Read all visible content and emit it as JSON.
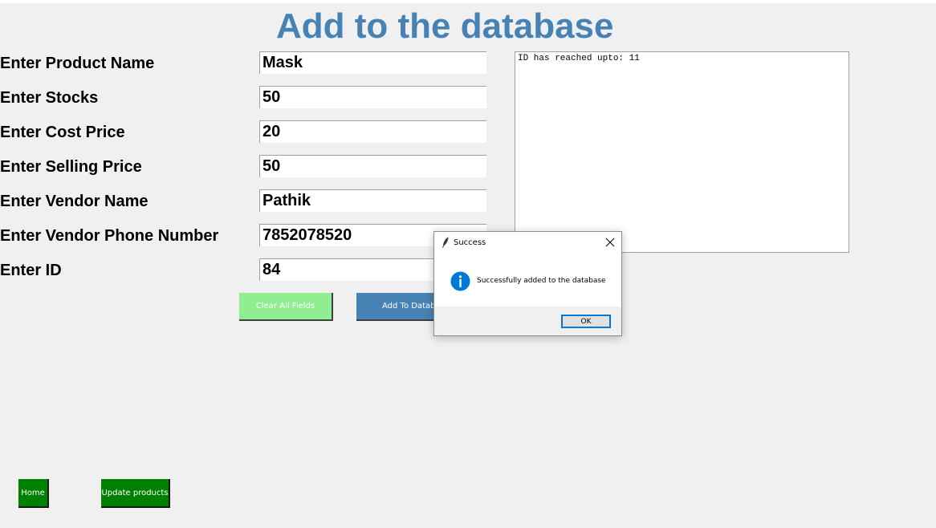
{
  "window": {
    "title": "Add to the database"
  },
  "form": {
    "fields": [
      {
        "label": "Enter Product Name",
        "value": "Mask"
      },
      {
        "label": "Enter Stocks",
        "value": "50"
      },
      {
        "label": "Enter Cost Price",
        "value": "20"
      },
      {
        "label": "Enter Selling Price",
        "value": "50"
      },
      {
        "label": "Enter Vendor Name",
        "value": "Pathik"
      },
      {
        "label": "Enter Vendor Phone Number",
        "value": "7852078520"
      },
      {
        "label": "Enter ID",
        "value": "84"
      }
    ],
    "clear_button": "Clear All Fields",
    "add_button": "Add To Database"
  },
  "output": {
    "text": "ID has reached upto: 11"
  },
  "nav": {
    "home_button": "Home",
    "update_button": "Update products"
  },
  "dialog": {
    "title": "Success",
    "icon": "info-icon",
    "message": "Successfully added to the database",
    "ok_button": "OK"
  },
  "colors": {
    "title": "#4682b4",
    "clear_button_bg": "#90ee90",
    "add_button_bg": "#4682b4",
    "nav_button_bg": "#008000",
    "background": "#f0f0f0",
    "info_icon": "#0078d7"
  }
}
